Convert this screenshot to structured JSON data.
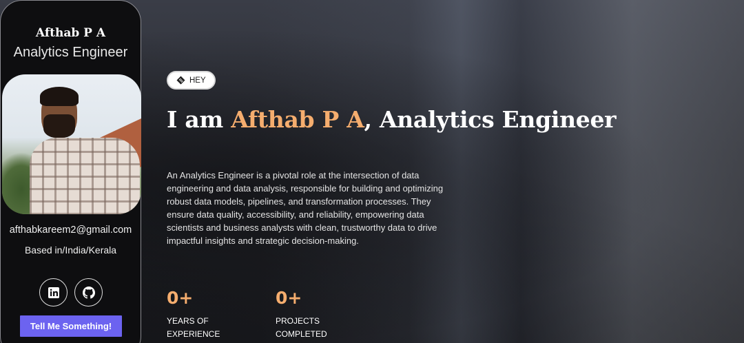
{
  "profile": {
    "name": "Afthab P A",
    "role": "Analytics Engineer",
    "email": "afthabkareem2@gmail.com",
    "location": "Based in/India/Kerala",
    "socials": [
      {
        "icon": "linkedin-icon"
      },
      {
        "icon": "github-icon"
      }
    ],
    "cta_label": "Tell Me Something!"
  },
  "hero": {
    "badge": "HEY",
    "headline_prefix": "I am ",
    "headline_name": "Afthab P A",
    "headline_suffix": ", Analytics Engineer",
    "intro": "An Analytics Engineer is a pivotal role at the intersection of data engineering and data analysis, responsible for building and optimizing robust data models, pipelines, and transformation processes. They ensure data quality, accessibility, and reliability, empowering data scientists and business analysts with clean, trustworthy data to drive impactful insights and strategic decision-making.",
    "stats": [
      {
        "value": "0+",
        "label_line1": "YEARS OF",
        "label_line2": "EXPERIENCE"
      },
      {
        "value": "0+",
        "label_line1": "PROJECTS",
        "label_line2": "COMPLETED"
      }
    ]
  },
  "colors": {
    "accent": "#f5ad6e",
    "button": "#6c63f0",
    "card_bg": "#0e0e10"
  }
}
